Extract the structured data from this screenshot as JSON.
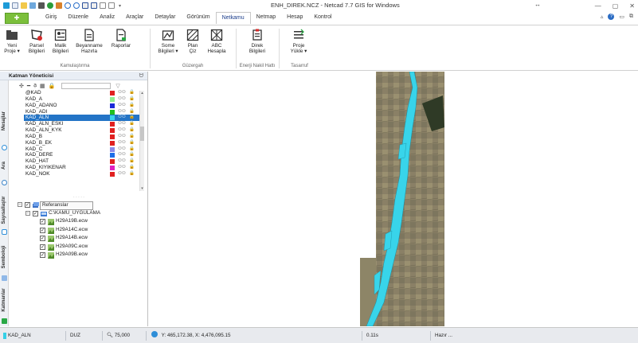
{
  "window": {
    "title": "ENH_DIREK.NCZ - Netcad 7.7 GIS for Windows",
    "extra_icon": "↔",
    "minimize": "—",
    "maximize": "▢",
    "close": "✕"
  },
  "ribbon_tabs": [
    "Giriş",
    "Düzenle",
    "Analiz",
    "Araçlar",
    "Detaylar",
    "Görünüm",
    "Netkamu",
    "Netmap",
    "Hesap",
    "Kontrol"
  ],
  "active_tab": "Netkamu",
  "ribbon": {
    "buttons": [
      {
        "id": "yeni-proje",
        "l1": "Yeni",
        "l2": "Proje ▾"
      },
      {
        "id": "parsel-bilgileri",
        "l1": "Parsel",
        "l2": "Bilgileri"
      },
      {
        "id": "malik-bilgileri",
        "l1": "Malik",
        "l2": "Bilgileri"
      },
      {
        "id": "beyanname-hazirla",
        "l1": "Beyanname",
        "l2": "Hazırla"
      },
      {
        "id": "raporlar",
        "l1": "Raporlar",
        "l2": ""
      },
      {
        "id": "some-bilgileri",
        "l1": "Some",
        "l2": "Bilgileri ▾"
      },
      {
        "id": "plan-ciz",
        "l1": "Plan",
        "l2": "Çiz"
      },
      {
        "id": "abc-hesapla",
        "l1": "ABC",
        "l2": "Hesapla"
      },
      {
        "id": "direk-bilgileri",
        "l1": "Direk",
        "l2": "Bilgileri"
      },
      {
        "id": "proje-yukle",
        "l1": "Proje",
        "l2": "Yükle ▾"
      }
    ],
    "groups": [
      "Kamulaştırma",
      "Güzergah",
      "Enerji Nakil Hattı",
      "Tasarruf"
    ]
  },
  "layer_panel": {
    "title": "Katman Yöneticisi",
    "pin": "ᗢ",
    "search_placeholder": "",
    "layers": [
      {
        "name": "@KAD",
        "color": "#e02020"
      },
      {
        "name": "KAD_A",
        "color": "#90ee90"
      },
      {
        "name": "KAD_ADANO",
        "color": "#1a2bd8"
      },
      {
        "name": "KAD_ADI",
        "color": "#20c020"
      },
      {
        "name": "KAD_ALN",
        "color": "#38d4ea"
      },
      {
        "name": "KAD_ALN_ESKI",
        "color": "#e02020"
      },
      {
        "name": "KAD_ALN_KYK",
        "color": "#e02020"
      },
      {
        "name": "KAD_B",
        "color": "#e02020"
      },
      {
        "name": "KAD_B_EK",
        "color": "#e02020"
      },
      {
        "name": "KAD_C",
        "color": "#8a8ae8"
      },
      {
        "name": "KAD_DERE",
        "color": "#1e6ee8"
      },
      {
        "name": "KAD_HAT",
        "color": "#e02020"
      },
      {
        "name": "KAD_KIYIKENAR",
        "color": "#e020c0"
      },
      {
        "name": "KAD_NOK",
        "color": "#e02020"
      }
    ],
    "selected_layer": "KAD_ALN",
    "vis_glyph": "⚇⚇",
    "lock_glyph": "🔒"
  },
  "vertical_tabs": [
    "Mesajlar",
    "Ara",
    "Sayısallaştır",
    "Semboloji",
    "Katmanlar"
  ],
  "references": {
    "root": "Referanslar",
    "folder": "C:\\KAMU_UYGULAMA",
    "files": [
      "H29A19B.ecw",
      "H29A14C.ecw",
      "H29A14B.ecw",
      "H29A09C.ecw",
      "H29A09B.ecw"
    ]
  },
  "statusbar": {
    "layer": "KAD_ALN",
    "mode": "DUZ",
    "scale": "75,000",
    "coords": "Y: 465,172.38, X: 4,476,095.15",
    "time": "0.11s",
    "state": "Hazır ..."
  },
  "colors": {
    "accent": "#2374c6",
    "app_button": "#7bbf3b",
    "map_feature": "#38d4ea"
  }
}
